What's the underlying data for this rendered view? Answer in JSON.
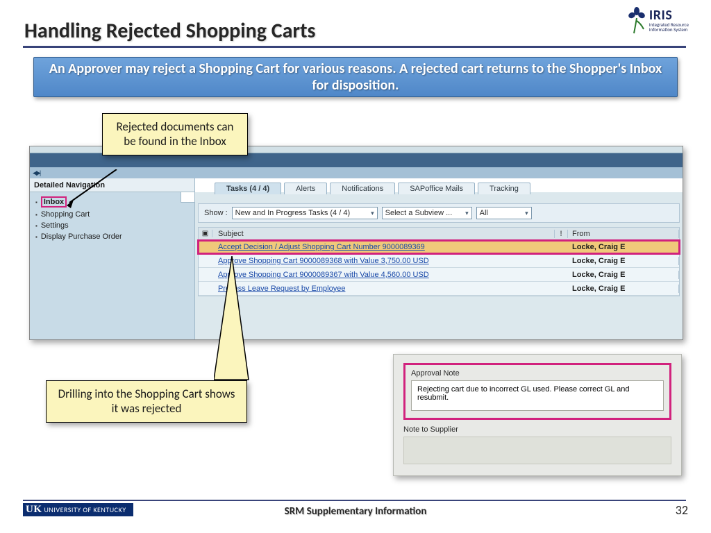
{
  "title": "Handling Rejected Shopping Carts",
  "iris": {
    "main": "IRIS",
    "sub1": "Integrated Resource",
    "sub2": "Information System"
  },
  "banner": "An Approver may reject a Shopping Cart for various reasons. A rejected cart returns to the Shopper's Inbox for disposition.",
  "callout1": "Rejected documents can be found in the Inbox",
  "callout2": "Drilling into the Shopping Cart shows it was rejected",
  "sap": {
    "detnav_header": "Detailed Navigation",
    "nav": {
      "inbox": "Inbox",
      "cart": "Shopping Cart",
      "settings": "Settings",
      "po": "Display Purchase Order"
    },
    "tabs": {
      "tasks": "Tasks (4 / 4)",
      "alerts": "Alerts",
      "notifications": "Notifications",
      "mails": "SAPoffice Mails",
      "tracking": "Tracking"
    },
    "show_label": "Show :",
    "dd1": "New and In Progress Tasks  (4 / 4)",
    "dd2": "Select a Subview ...",
    "dd3": "All",
    "grid_head": {
      "subject": "Subject",
      "excl": "!",
      "from": "From"
    },
    "rows": [
      {
        "subject": "Accept Decision / Adjust Shopping Cart Number 9000089369",
        "from": "Locke, Craig E",
        "hi": true
      },
      {
        "subject": "Approve Shopping Cart 9000089368 with Value 3,750.00 USD",
        "from": "Locke, Craig E",
        "hi": false
      },
      {
        "subject": "Approve Shopping Cart 9000089367 with Value 4,560.00 USD",
        "from": "Locke, Craig E",
        "hi": false
      },
      {
        "subject": "Process Leave Request by Employee",
        "from": "Locke, Craig E",
        "hi": false
      }
    ]
  },
  "note": {
    "approval_label": "Approval Note",
    "approval_text": "Rejecting cart due to incorrect GL used. Please correct GL and resubmit.",
    "supplier_label": "Note to Supplier"
  },
  "footer": {
    "uk": "UNIVERSITY OF KENTUCKY",
    "center": "SRM Supplementary Information",
    "page": "32"
  }
}
